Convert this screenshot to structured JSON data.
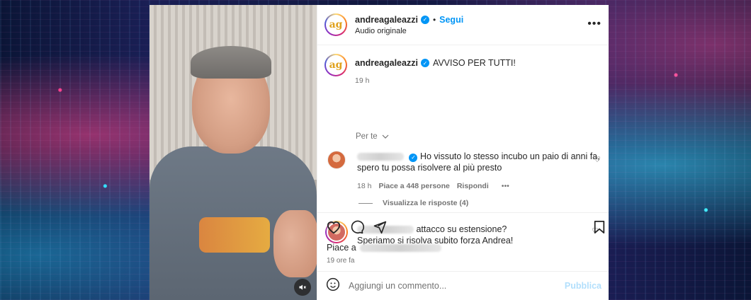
{
  "header": {
    "username": "andreagaleazzi",
    "separator": "•",
    "follow_label": "Segui",
    "subtitle": "Audio originale",
    "avatar_letters": "ag",
    "more_icon": "more-horizontal-icon"
  },
  "caption": {
    "username": "andreagaleazzi",
    "text": "AVVISO PER TUTTI!",
    "time": "19 h"
  },
  "filter": {
    "label": "Per te",
    "icon": "chevron-down-icon"
  },
  "comments": [
    {
      "text_line1": "Ho vissuto lo stesso incubo un paio di anni fa,",
      "text_line2": "spero tu possa risolvere al più presto",
      "time": "18 h",
      "likes": "Piace a 448 persone",
      "reply_label": "Rispondi",
      "more": "•••",
      "view_replies": "Visualizza le risposte (4)"
    },
    {
      "text_line1": "attacco su estensione?",
      "text_line2": "Speriamo si risolva subito forza Andrea!"
    }
  ],
  "likes_prefix": "Piace a",
  "post_time": "19 ore fa",
  "composer": {
    "placeholder": "Aggiungi un commento...",
    "publish_label": "Pubblica"
  },
  "colors": {
    "accent": "#0095f6",
    "publish_disabled": "#b2dffc",
    "text": "#262626",
    "muted": "#737373"
  }
}
